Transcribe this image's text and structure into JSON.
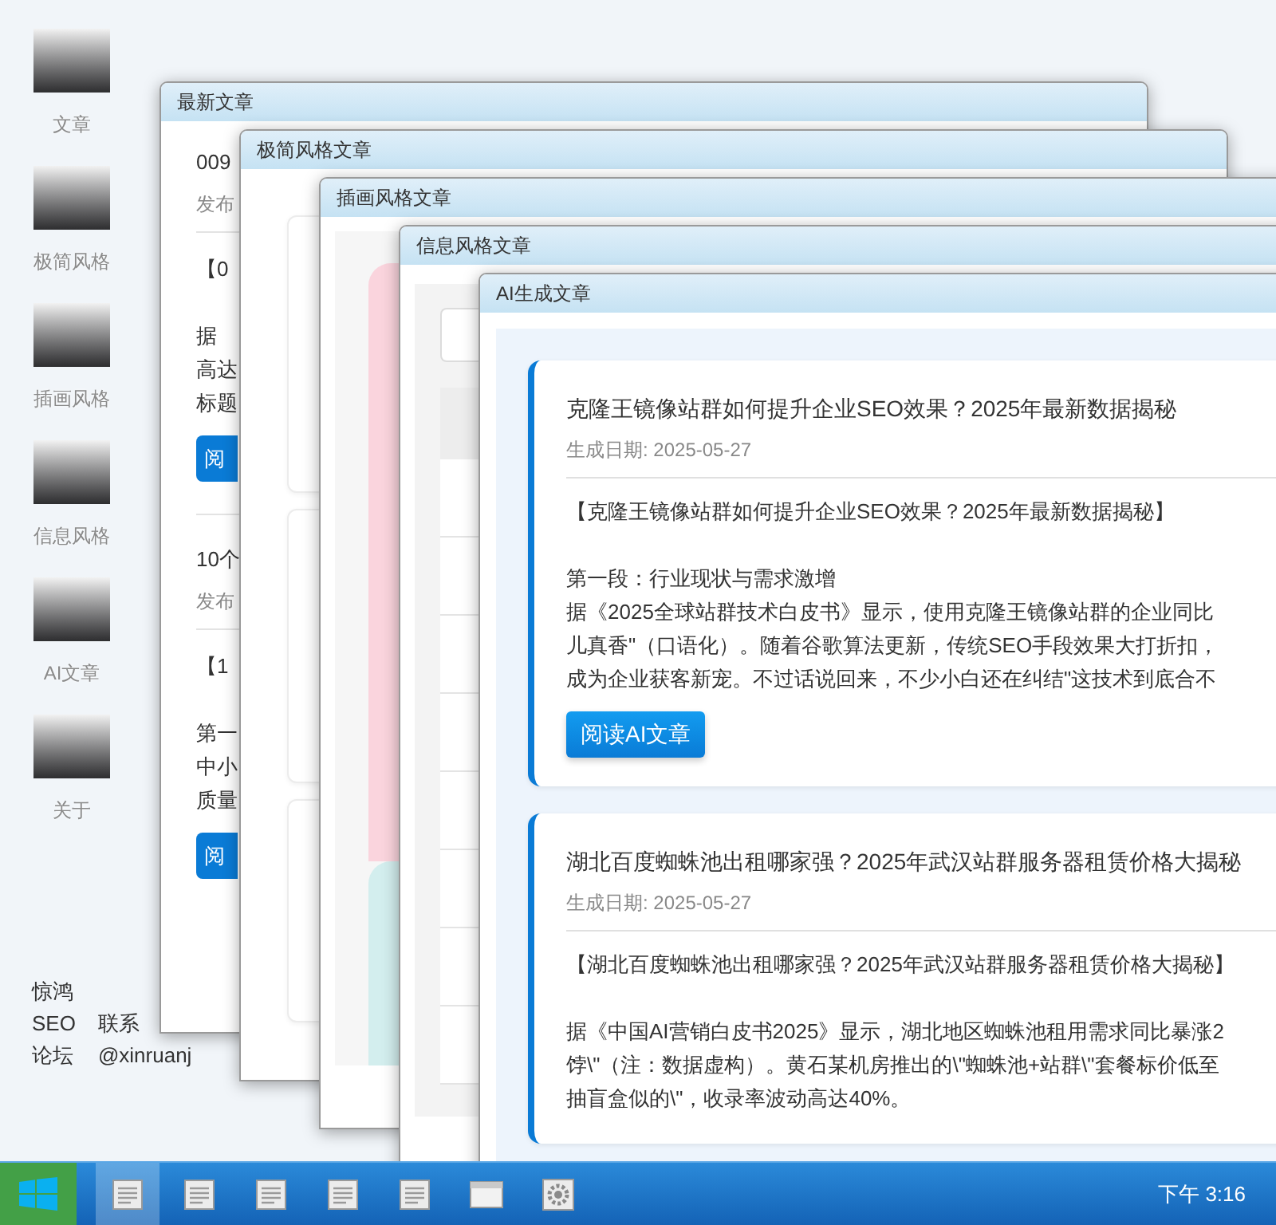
{
  "desktop_icons": [
    {
      "label": "文章"
    },
    {
      "label": "极简风格"
    },
    {
      "label": "插画风格"
    },
    {
      "label": "信息风格"
    },
    {
      "label": "AI文章"
    },
    {
      "label": "关于"
    }
  ],
  "footer": {
    "site": "惊鸿SEO论坛",
    "contact": "联系@xinruanj"
  },
  "windows": [
    {
      "title": "最新文章",
      "kind": "list",
      "items": [
        {
          "title": "009",
          "meta": "发布",
          "lead": "【0",
          "body": [
            "据",
            "高达",
            "标题"
          ],
          "button": "阅"
        },
        {
          "title": "10个",
          "meta": "发布",
          "lead": "【1",
          "body": [
            "第一",
            "中小",
            "质量"
          ],
          "button": "阅"
        }
      ]
    },
    {
      "title": "极简风格文章",
      "kind": "cards"
    },
    {
      "title": "插画风格文章",
      "kind": "illustrated"
    },
    {
      "title": "信息风格文章",
      "kind": "table"
    },
    {
      "title": "AI生成文章",
      "kind": "ai",
      "articles": [
        {
          "title": "克隆王镜像站群如何提升企业SEO效果？2025年最新数据揭秘",
          "date": "生成日期: 2025-05-27",
          "lead": "【克隆王镜像站群如何提升企业SEO效果？2025年最新数据揭秘】",
          "body": [
            "第一段：行业现状与需求激增",
            "据《2025全球站群技术白皮书》显示，使用克隆王镜像站群的企业同比",
            "儿真香\"（口语化）。随着谷歌算法更新，传统SEO手段效果大打折扣，",
            "成为企业获客新宠。不过话说回来，不少小白还在纠结\"这技术到底合不"
          ],
          "button": "阅读AI文章"
        },
        {
          "title": "湖北百度蜘蛛池出租哪家强？2025年武汉站群服务器租赁价格大揭秘",
          "date": "生成日期: 2025-05-27",
          "lead": "【湖北百度蜘蛛池出租哪家强？2025年武汉站群服务器租赁价格大揭秘】",
          "body": [
            "据《中国AI营销白皮书2025》显示，湖北地区蜘蛛池租用需求同比暴涨2",
            "饽\\\"（注：数据虚构）。黄石某机房推出的\\\"蜘蛛池+站群\\\"套餐标价低至",
            "抽盲盒似的\\\"，收录率波动高达40%。"
          ]
        }
      ]
    }
  ],
  "taskbar": {
    "apps": [
      {
        "kind": "document",
        "selected": true
      },
      {
        "kind": "document",
        "selected": false
      },
      {
        "kind": "document",
        "selected": false
      },
      {
        "kind": "document",
        "selected": false
      },
      {
        "kind": "document",
        "selected": false
      },
      {
        "kind": "browser",
        "selected": false
      },
      {
        "kind": "settings",
        "selected": false
      }
    ],
    "clock": "下午 3:16"
  }
}
